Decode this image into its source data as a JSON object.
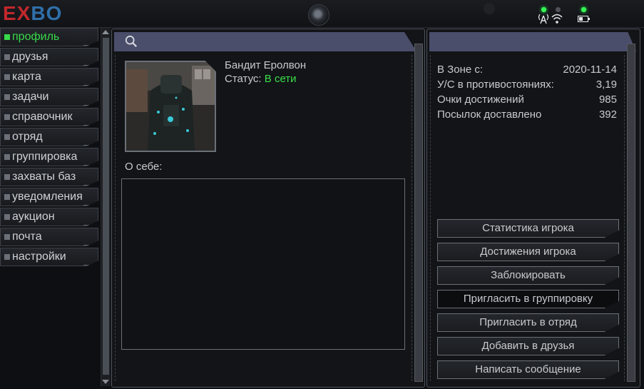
{
  "app": {
    "logo_a": "EX",
    "logo_b": "BO"
  },
  "nav": {
    "items": [
      {
        "label": "профиль",
        "active": true
      },
      {
        "label": "друзья"
      },
      {
        "label": "карта"
      },
      {
        "label": "задачи"
      },
      {
        "label": "справочник"
      },
      {
        "label": "отряд"
      },
      {
        "label": "группировка"
      },
      {
        "label": "захваты баз"
      },
      {
        "label": "уведомления"
      },
      {
        "label": "аукцион"
      },
      {
        "label": "почта"
      },
      {
        "label": "настройки"
      }
    ]
  },
  "profile": {
    "name": "Бандит Еролвон",
    "status_label": "Статус:",
    "status_value": "В сети",
    "about_label": "О себе:",
    "about_text": ""
  },
  "stats": [
    {
      "label": "В Зоне с:",
      "value": "2020-11-14"
    },
    {
      "label": "У/С в противостояниях:",
      "value": "3,19"
    },
    {
      "label": "Очки достижений",
      "value": "985"
    },
    {
      "label": "Посылок доставлено",
      "value": "392"
    }
  ],
  "actions": [
    "Статистика игрока",
    "Достижения игрока",
    "Заблокировать",
    "Пригласить в группировку",
    "Пригласить в отряд",
    "Добавить в друзья",
    "Написать сообщение"
  ],
  "colors": {
    "accent_green": "#38e04a",
    "header_bar": "#4b4e6a",
    "logo_red": "#c0282c",
    "logo_blue": "#2f6fa8"
  }
}
